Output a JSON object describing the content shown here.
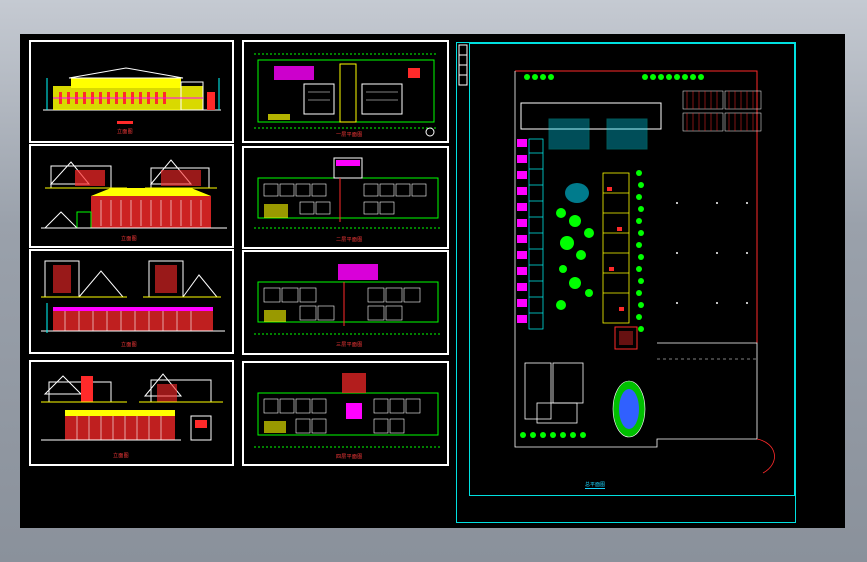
{
  "viewer": {
    "background": "#000000",
    "chrome_gradient": [
      "#c5cad2",
      "#8a919b"
    ]
  },
  "sheets": [
    {
      "id": "sheet-1",
      "kind": "elevation",
      "caption": "立面图"
    },
    {
      "id": "sheet-2",
      "kind": "floor-plan",
      "caption": "一层平面图"
    },
    {
      "id": "sheet-3",
      "kind": "elevation-section",
      "caption": "立面图"
    },
    {
      "id": "sheet-4",
      "kind": "floor-plan",
      "caption": "二层平面图"
    },
    {
      "id": "sheet-5",
      "kind": "elevation-section",
      "caption": "立面图"
    },
    {
      "id": "sheet-6",
      "kind": "floor-plan",
      "caption": "三层平面图"
    },
    {
      "id": "sheet-7",
      "kind": "elevation-section",
      "caption": "立面图"
    },
    {
      "id": "sheet-8",
      "kind": "floor-plan",
      "caption": "四层平面图"
    }
  ],
  "site_plan": {
    "title": "总平面图",
    "frame_color": "#00e0e0"
  },
  "colors": {
    "cad_white": "#ffffff",
    "cad_yellow": "#ffff00",
    "cad_red": "#ff2a2a",
    "cad_magenta": "#ff00ff",
    "cad_green": "#00ff00",
    "cad_cyan": "#00ffff",
    "cad_blue": "#3060ff"
  }
}
